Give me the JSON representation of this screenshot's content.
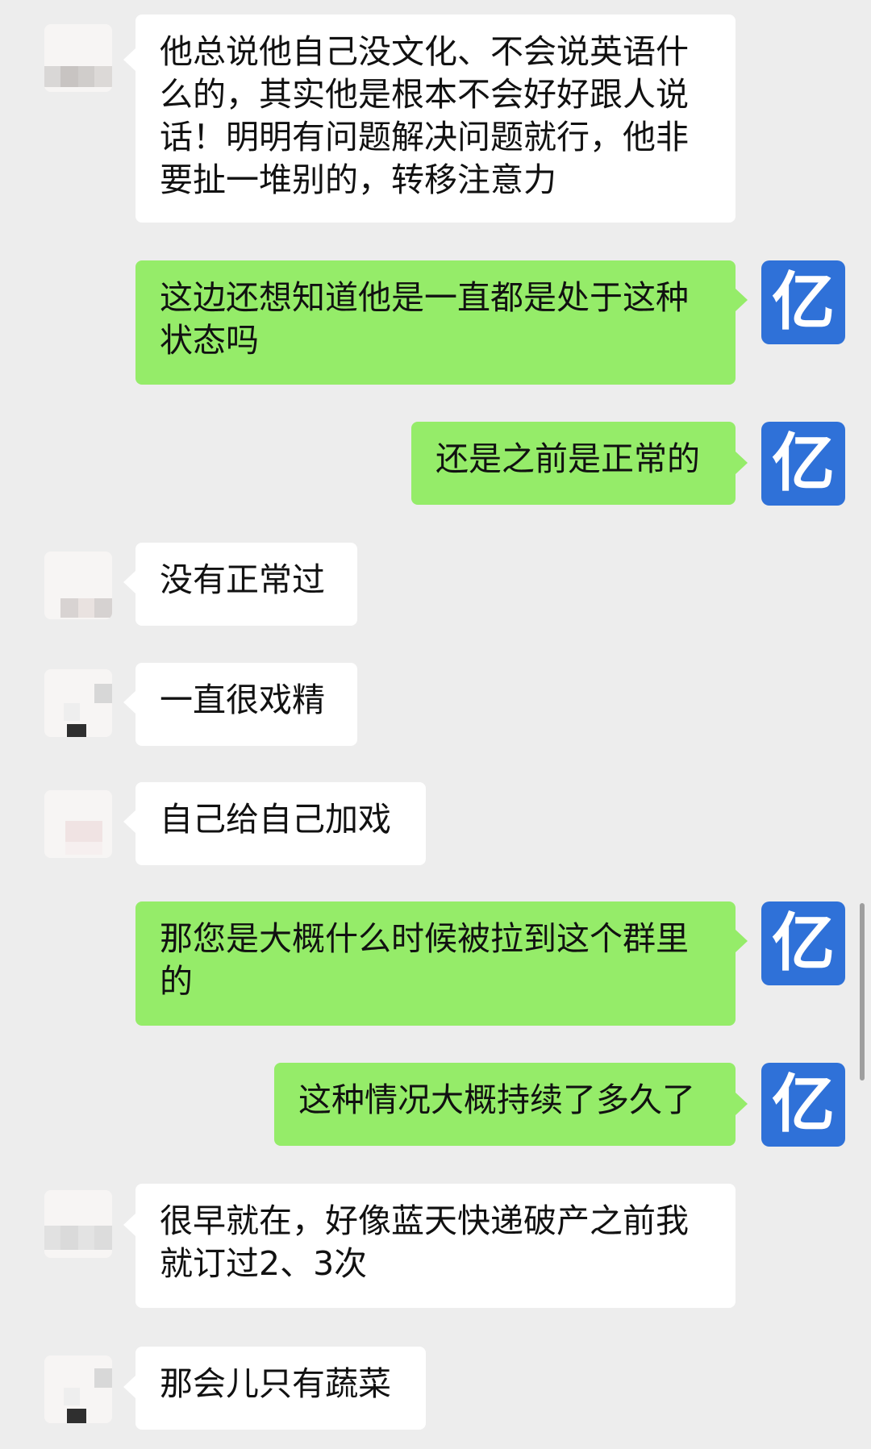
{
  "messages": [
    {
      "sender": "other",
      "text": "他总说他自己没文化、不会说英语什么的，其实他是根本不会好好跟人说话！明明有问题解决问题就行，他非要扯一堆别的，转移注意力"
    },
    {
      "sender": "self",
      "text": "这边还想知道他是一直都是处于这种状态吗"
    },
    {
      "sender": "self",
      "text": "还是之前是正常的"
    },
    {
      "sender": "other",
      "text": "没有正常过"
    },
    {
      "sender": "other",
      "text": "一直很戏精"
    },
    {
      "sender": "other",
      "text": "自己给自己加戏"
    },
    {
      "sender": "self",
      "text": "那您是大概什么时候被拉到这个群里的"
    },
    {
      "sender": "self",
      "text": "这种情况大概持续了多久了"
    },
    {
      "sender": "other",
      "text": "很早就在，好像蓝天快递破产之前我就订过2、3次"
    },
    {
      "sender": "other",
      "text": "那会儿只有蔬菜"
    }
  ],
  "self_avatar": {
    "glyph": "亿",
    "color": "#2f71d8"
  },
  "colors": {
    "background": "#ededed",
    "self_bubble": "#95ec69",
    "other_bubble": "#ffffff"
  }
}
